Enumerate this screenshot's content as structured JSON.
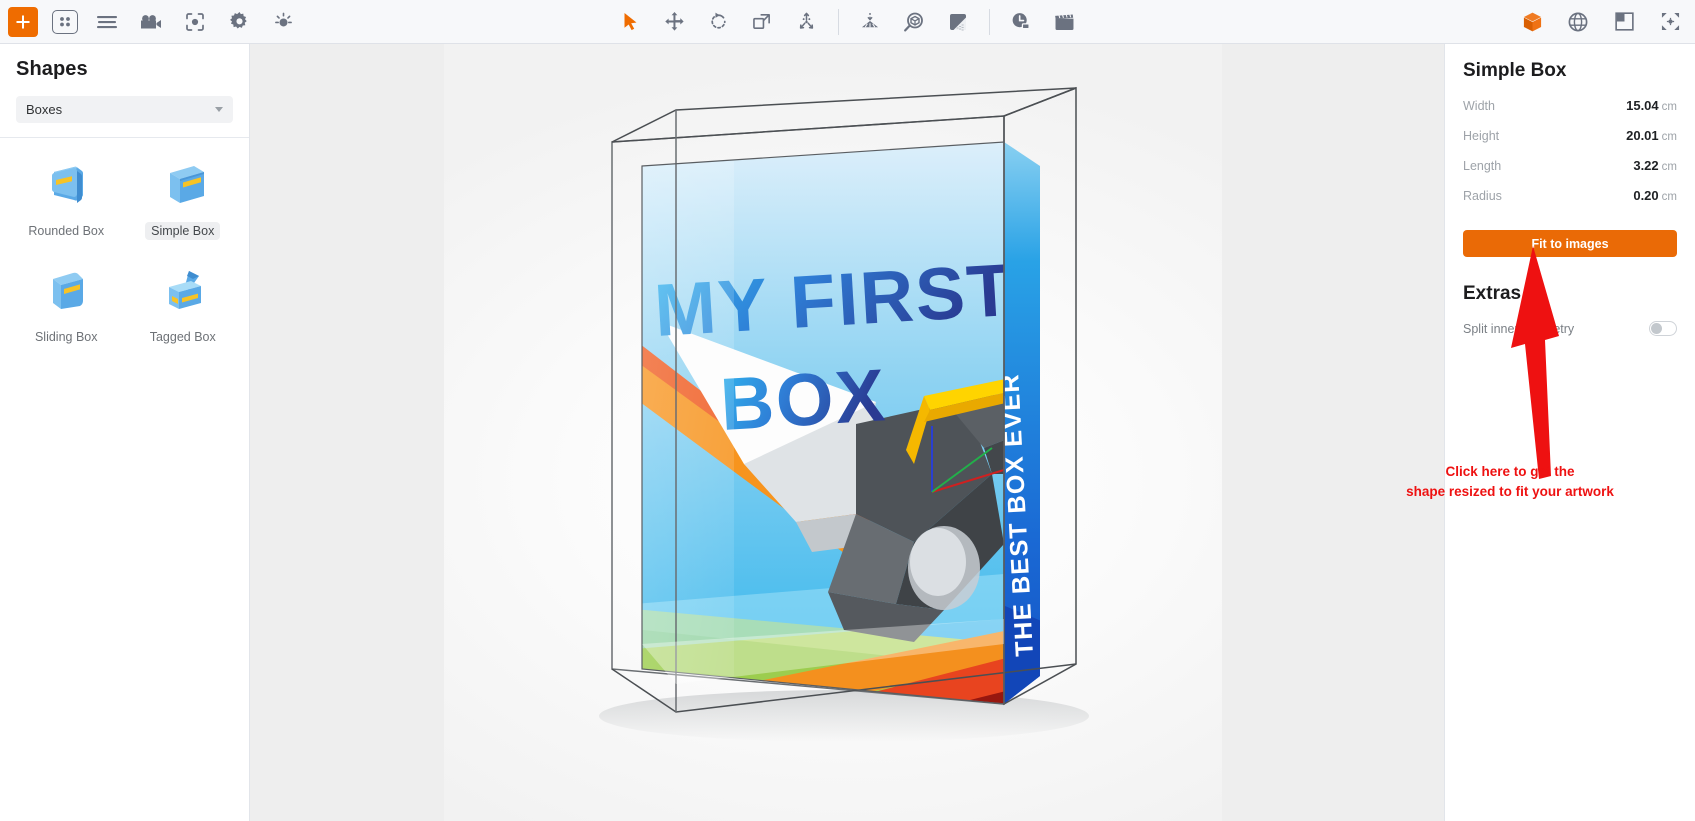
{
  "toolbar": {
    "left_icons": [
      {
        "name": "add-icon",
        "label": "Add"
      },
      {
        "name": "grid-layout-icon",
        "label": "Layouts"
      },
      {
        "name": "list-lines-icon",
        "label": "List"
      },
      {
        "name": "movie-camera-icon",
        "label": "Camera"
      },
      {
        "name": "focus-frame-icon",
        "label": "Focus"
      },
      {
        "name": "gear-icon",
        "label": "Settings"
      },
      {
        "name": "brightness-icon",
        "label": "Lighting"
      }
    ],
    "center_group_1": [
      {
        "name": "select-cursor-icon",
        "label": "Select"
      },
      {
        "name": "move-icon",
        "label": "Move"
      },
      {
        "name": "rotate-icon",
        "label": "Rotate"
      },
      {
        "name": "scale-icon",
        "label": "Scale"
      },
      {
        "name": "explode-icon",
        "label": "Explode"
      }
    ],
    "center_group_2": [
      {
        "name": "perspective-grid-icon",
        "label": "Perspective"
      },
      {
        "name": "inspect-3d-icon",
        "label": "Inspect"
      },
      {
        "name": "material-swatch-icon",
        "label": "Material"
      }
    ],
    "center_group_3": [
      {
        "name": "history-clock-icon",
        "label": "History"
      },
      {
        "name": "clapperboard-icon",
        "label": "Animate"
      }
    ],
    "right_icons": [
      {
        "name": "cube-3d-icon",
        "label": "3D View"
      },
      {
        "name": "sphere-wireframe-icon",
        "label": "Environment"
      },
      {
        "name": "image-corner-icon",
        "label": "Render"
      },
      {
        "name": "fullscreen-icon",
        "label": "Fullscreen"
      }
    ]
  },
  "sidebar": {
    "title": "Shapes",
    "category_select": {
      "value": "Boxes",
      "caret_icon": "chevron-down-icon"
    },
    "shapes": [
      {
        "label": "Rounded Box",
        "selected": false,
        "icon": "rounded-box-icon"
      },
      {
        "label": "Simple Box",
        "selected": true,
        "icon": "simple-box-icon"
      },
      {
        "label": "Sliding Box",
        "selected": false,
        "icon": "sliding-box-icon"
      },
      {
        "label": "Tagged Box",
        "selected": false,
        "icon": "tagged-box-icon"
      }
    ]
  },
  "artwork": {
    "title_line_1": "MY FIRST",
    "title_line_2": "BOX",
    "spine_text": "THE BEST BOX EVER",
    "colors": {
      "front_sky_top": "#d7eefb",
      "front_sky_bottom": "#3fb8ec",
      "spine_blue_top": "#1f8fe0",
      "spine_blue_bottom": "#1558c8",
      "orange": "#f07b22",
      "red": "#e0391c",
      "green": "#a8d45a",
      "yellow": "#ffd400",
      "bird_dark": "#4a4f54",
      "bird_light": "#e9ebee"
    }
  },
  "inspector": {
    "title": "Simple Box",
    "properties": [
      {
        "name": "Width",
        "value": "15.04",
        "unit": "cm"
      },
      {
        "name": "Height",
        "value": "20.01",
        "unit": "cm"
      },
      {
        "name": "Length",
        "value": "3.22",
        "unit": "cm"
      },
      {
        "name": "Radius",
        "value": "0.20",
        "unit": "cm"
      }
    ],
    "fit_button_label": "Fit to images",
    "fit_button_color": "#ea6a06",
    "extras_title": "Extras",
    "extras": [
      {
        "label": "Split inner geometry",
        "enabled": false
      }
    ]
  },
  "annotation": {
    "line_1": "Click here to get the",
    "line_2": "shape resized to fit your artwork",
    "color": "#ee1111",
    "arrow_icon": "red-arrow-up-icon"
  }
}
